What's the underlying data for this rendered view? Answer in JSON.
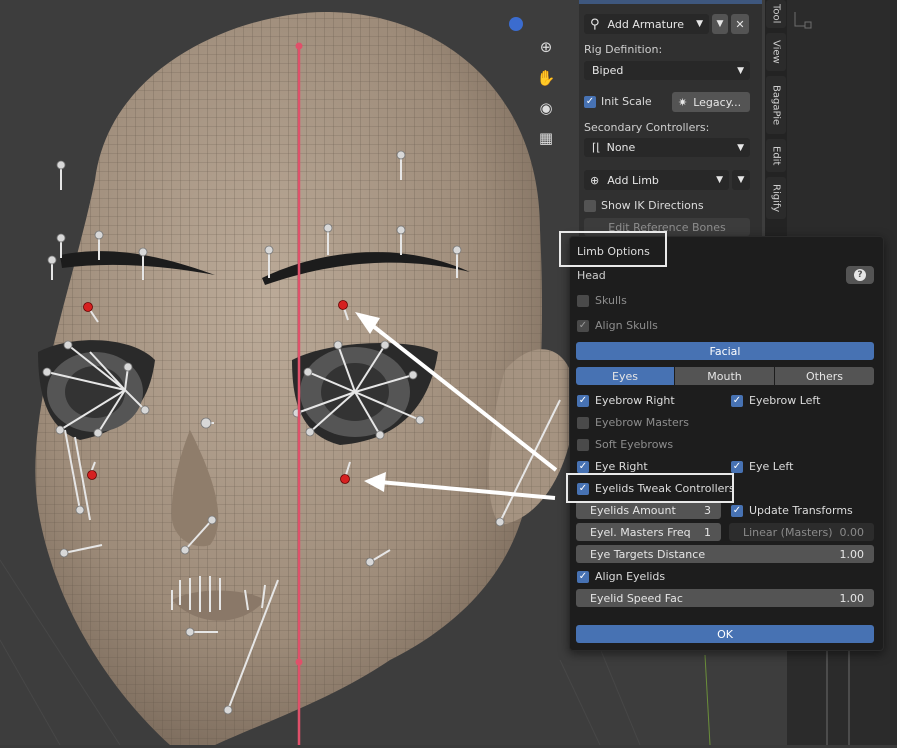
{
  "sidebar": {
    "add_armature": "Add Armature",
    "rig_definition_label": "Rig Definition:",
    "rig_definition_value": "Biped",
    "init_scale": "Init Scale",
    "legacy_button": "Legacy...",
    "secondary_controllers_label": "Secondary Controllers:",
    "secondary_controllers_value": "None",
    "add_limb": "Add Limb",
    "show_ik_directions": "Show IK Directions",
    "edit_reference_bones": "Edit Reference Bones",
    "tabs": [
      "Tool",
      "View",
      "BagaPie",
      "Edit",
      "Rigify"
    ]
  },
  "popup": {
    "title": "Limb Options",
    "section": "Head",
    "skulls": "Skulls",
    "align_skulls": "Align Skulls",
    "facial_button": "Facial",
    "subtabs": [
      "Eyes",
      "Mouth",
      "Others"
    ],
    "eyebrow_right": "Eyebrow Right",
    "eyebrow_left": "Eyebrow Left",
    "eyebrow_masters": "Eyebrow Masters",
    "soft_eyebrows": "Soft Eyebrows",
    "eye_right": "Eye Right",
    "eye_left": "Eye Left",
    "eyelids_tweak": "Eyelids Tweak Controllers",
    "eyelids_amount_label": "Eyelids Amount",
    "eyelids_amount_value": "3",
    "update_transforms": "Update Transforms",
    "eyel_masters_freq_label": "Eyel. Masters Freq",
    "eyel_masters_freq_value": "1",
    "linear_masters_label": "Linear (Masters)",
    "linear_masters_value": "0.00",
    "eye_targets_distance_label": "Eye Targets Distance",
    "eye_targets_distance_value": "1.00",
    "align_eyelids": "Align Eyelids",
    "eyelid_speed_fac_label": "Eyelid Speed Fac",
    "eyelid_speed_fac_value": "1.00",
    "ok_button": "OK"
  },
  "colors": {
    "accent": "#4772b3",
    "panel": "#1d1d1d",
    "skin": "#a89684",
    "bone_red": "#d62020",
    "axis_line": "#e0506a"
  },
  "icons": [
    "armature-icon",
    "chevron-down-icon",
    "close-icon",
    "zoom-icon",
    "hand-icon",
    "camera-icon",
    "grid-icon",
    "scale-icon",
    "controller-icon",
    "add-icon",
    "help-icon"
  ]
}
